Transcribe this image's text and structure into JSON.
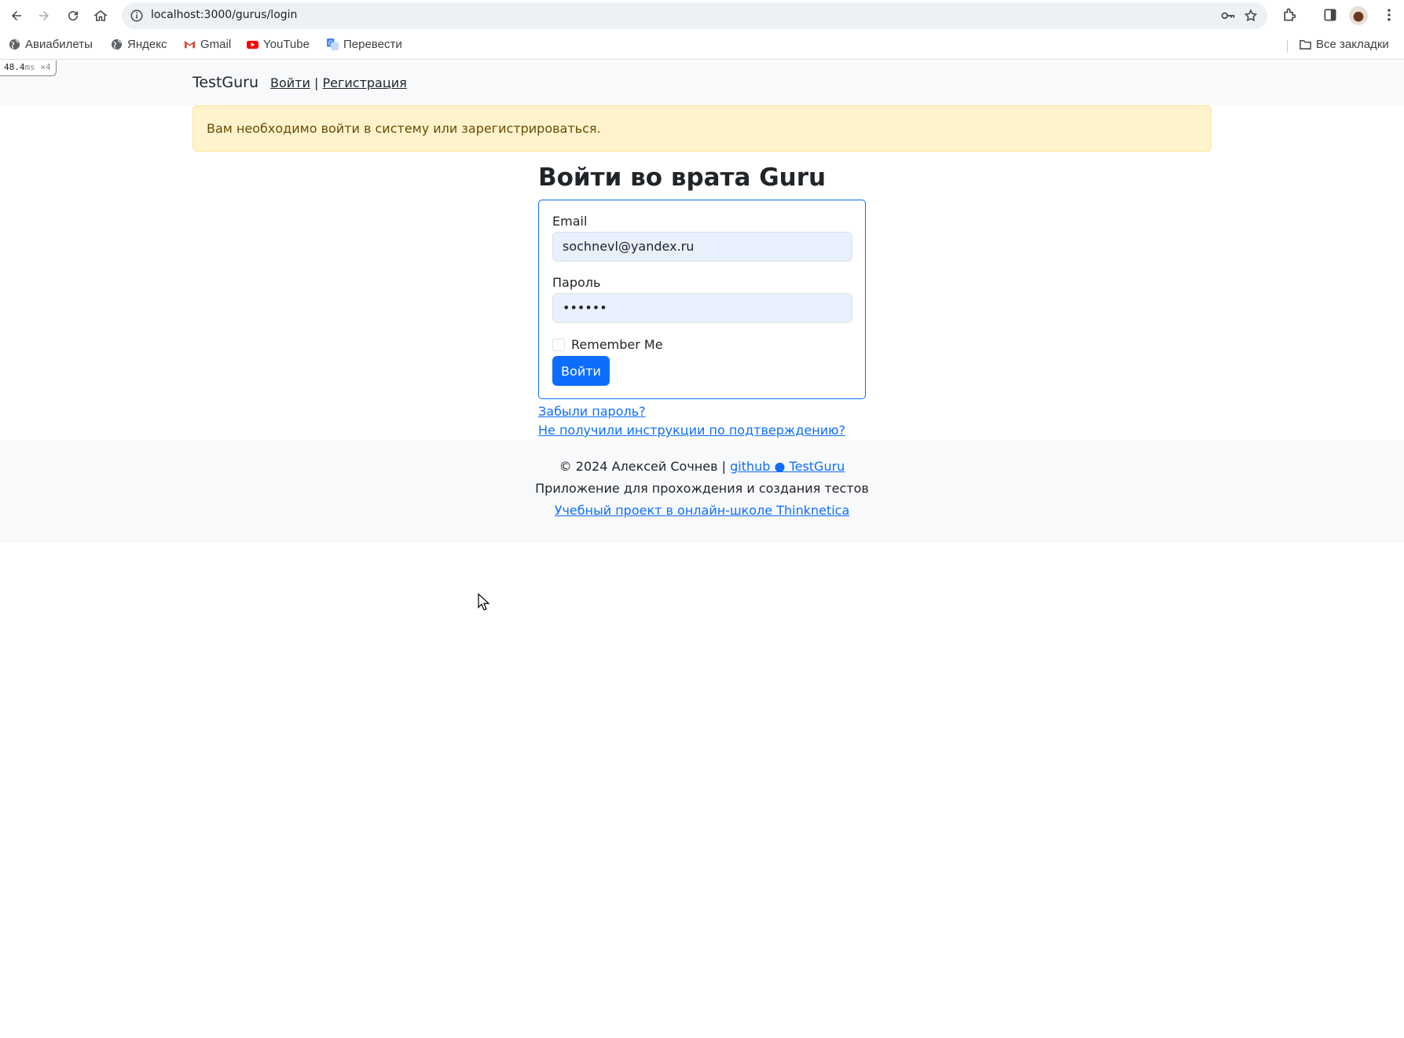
{
  "browser": {
    "url": "localhost:3000/gurus/login",
    "bookmarks": [
      {
        "label": "Авиабилеты",
        "icon": "globe-icon"
      },
      {
        "label": "Яндекс",
        "icon": "globe-icon"
      },
      {
        "label": "Gmail",
        "icon": "gmail-icon"
      },
      {
        "label": "YouTube",
        "icon": "youtube-icon"
      },
      {
        "label": "Перевести",
        "icon": "translate-icon"
      }
    ],
    "all_bookmarks": "Все закладки"
  },
  "perf": {
    "value": "48.4",
    "unit": "ms",
    "count": "×4"
  },
  "header": {
    "brand": "TestGuru",
    "login": "Войти",
    "separator": "|",
    "register": "Регистрация"
  },
  "alert": {
    "text": "Вам необходимо войти в систему или зарегистрироваться."
  },
  "form": {
    "title": "Войти во врата Guru",
    "email_label": "Email",
    "email_value": "sochnevl@yandex.ru",
    "password_label": "Пароль",
    "password_value": "••••••",
    "remember_label": "Remember Me",
    "submit_label": "Войти"
  },
  "links": {
    "forgot": "Забыли пароль?",
    "no_instructions": "Не получили инструкции по подтверждению?"
  },
  "footer": {
    "copyright": "© 2024 Алексей Сочнев |",
    "github_link": "github ● TestGuru",
    "description": "Приложение для прохождения и создания тестов",
    "school_link": "Учебный проект в онлайн-школе Thinknetica"
  },
  "colors": {
    "primary": "#0d6efd",
    "alert_bg": "#fff3cd",
    "alert_text": "#664d03",
    "header_bg": "#f8f9fa"
  }
}
